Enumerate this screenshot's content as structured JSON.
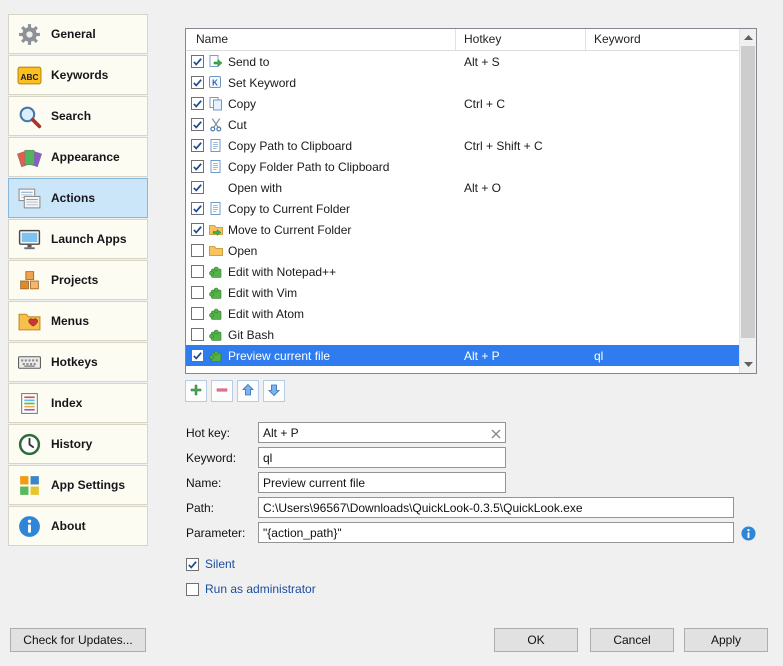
{
  "sidebar": {
    "items": [
      {
        "label": "General",
        "icon": "gear",
        "selected": false
      },
      {
        "label": "Keywords",
        "icon": "abc",
        "selected": false
      },
      {
        "label": "Search",
        "icon": "search",
        "selected": false
      },
      {
        "label": "Appearance",
        "icon": "appearance",
        "selected": false
      },
      {
        "label": "Actions",
        "icon": "actions",
        "selected": true
      },
      {
        "label": "Launch Apps",
        "icon": "launch",
        "selected": false
      },
      {
        "label": "Projects",
        "icon": "projects",
        "selected": false
      },
      {
        "label": "Menus",
        "icon": "menus",
        "selected": false
      },
      {
        "label": "Hotkeys",
        "icon": "hotkeys",
        "selected": false
      },
      {
        "label": "Index",
        "icon": "index",
        "selected": false
      },
      {
        "label": "History",
        "icon": "history",
        "selected": false
      },
      {
        "label": "App Settings",
        "icon": "appsettings",
        "selected": false
      },
      {
        "label": "About",
        "icon": "about",
        "selected": false
      }
    ]
  },
  "actions_table": {
    "columns": [
      "Name",
      "Hotkey",
      "Keyword"
    ],
    "rows": [
      {
        "checked": true,
        "icon": "send-to",
        "name": "Send to",
        "hotkey": "Alt + S",
        "keyword": "",
        "selected": false
      },
      {
        "checked": true,
        "icon": "set-keyword",
        "name": "Set Keyword",
        "hotkey": "",
        "keyword": "",
        "selected": false
      },
      {
        "checked": true,
        "icon": "copy",
        "name": "Copy",
        "hotkey": "Ctrl + C",
        "keyword": "",
        "selected": false
      },
      {
        "checked": true,
        "icon": "cut",
        "name": "Cut",
        "hotkey": "",
        "keyword": "",
        "selected": false
      },
      {
        "checked": true,
        "icon": "page",
        "name": "Copy Path to Clipboard",
        "hotkey": "Ctrl + Shift + C",
        "keyword": "",
        "selected": false
      },
      {
        "checked": true,
        "icon": "page",
        "name": "Copy Folder Path to Clipboard",
        "hotkey": "",
        "keyword": "",
        "selected": false
      },
      {
        "checked": true,
        "icon": "blank",
        "name": "Open with",
        "hotkey": "Alt + O",
        "keyword": "",
        "selected": false
      },
      {
        "checked": true,
        "icon": "page",
        "name": "Copy to Current Folder",
        "hotkey": "",
        "keyword": "",
        "selected": false
      },
      {
        "checked": true,
        "icon": "folder-move",
        "name": "Move to Current Folder",
        "hotkey": "",
        "keyword": "",
        "selected": false
      },
      {
        "checked": false,
        "icon": "folder",
        "name": "Open",
        "hotkey": "",
        "keyword": "",
        "selected": false
      },
      {
        "checked": false,
        "icon": "puzzle",
        "name": "Edit with Notepad++",
        "hotkey": "",
        "keyword": "",
        "selected": false
      },
      {
        "checked": false,
        "icon": "puzzle",
        "name": "Edit with Vim",
        "hotkey": "",
        "keyword": "",
        "selected": false
      },
      {
        "checked": false,
        "icon": "puzzle",
        "name": "Edit with Atom",
        "hotkey": "",
        "keyword": "",
        "selected": false
      },
      {
        "checked": false,
        "icon": "puzzle",
        "name": "Git Bash",
        "hotkey": "",
        "keyword": "",
        "selected": false
      },
      {
        "checked": true,
        "icon": "puzzle",
        "name": "Preview current file",
        "hotkey": "Alt + P",
        "keyword": "ql",
        "selected": true
      }
    ]
  },
  "toolbar": {
    "buttons": [
      {
        "name": "add",
        "icon": "plus"
      },
      {
        "name": "remove",
        "icon": "minus"
      },
      {
        "name": "move-up",
        "icon": "arrow-up"
      },
      {
        "name": "move-down",
        "icon": "arrow-down"
      }
    ]
  },
  "form": {
    "hotkey": {
      "label": "Hot key:",
      "value": "Alt + P"
    },
    "keyword": {
      "label": "Keyword:",
      "value": "ql"
    },
    "name": {
      "label": "Name:",
      "value": "Preview current file"
    },
    "path": {
      "label": "Path:",
      "value": "C:\\Users\\96567\\Downloads\\QuickLook-0.3.5\\QuickLook.exe"
    },
    "parameter": {
      "label": "Parameter:",
      "value": "\"{action_path}\""
    },
    "silent": {
      "label": "Silent",
      "checked": true
    },
    "run_as_admin": {
      "label": "Run as administrator",
      "checked": false
    }
  },
  "footer": {
    "check_updates": "Check for Updates...",
    "ok": "OK",
    "cancel": "Cancel",
    "apply": "Apply"
  },
  "colors": {
    "selection": "#2e7cf0",
    "sidebar_selected": "#cce6f9",
    "accent_label": "#1c4ea0"
  }
}
